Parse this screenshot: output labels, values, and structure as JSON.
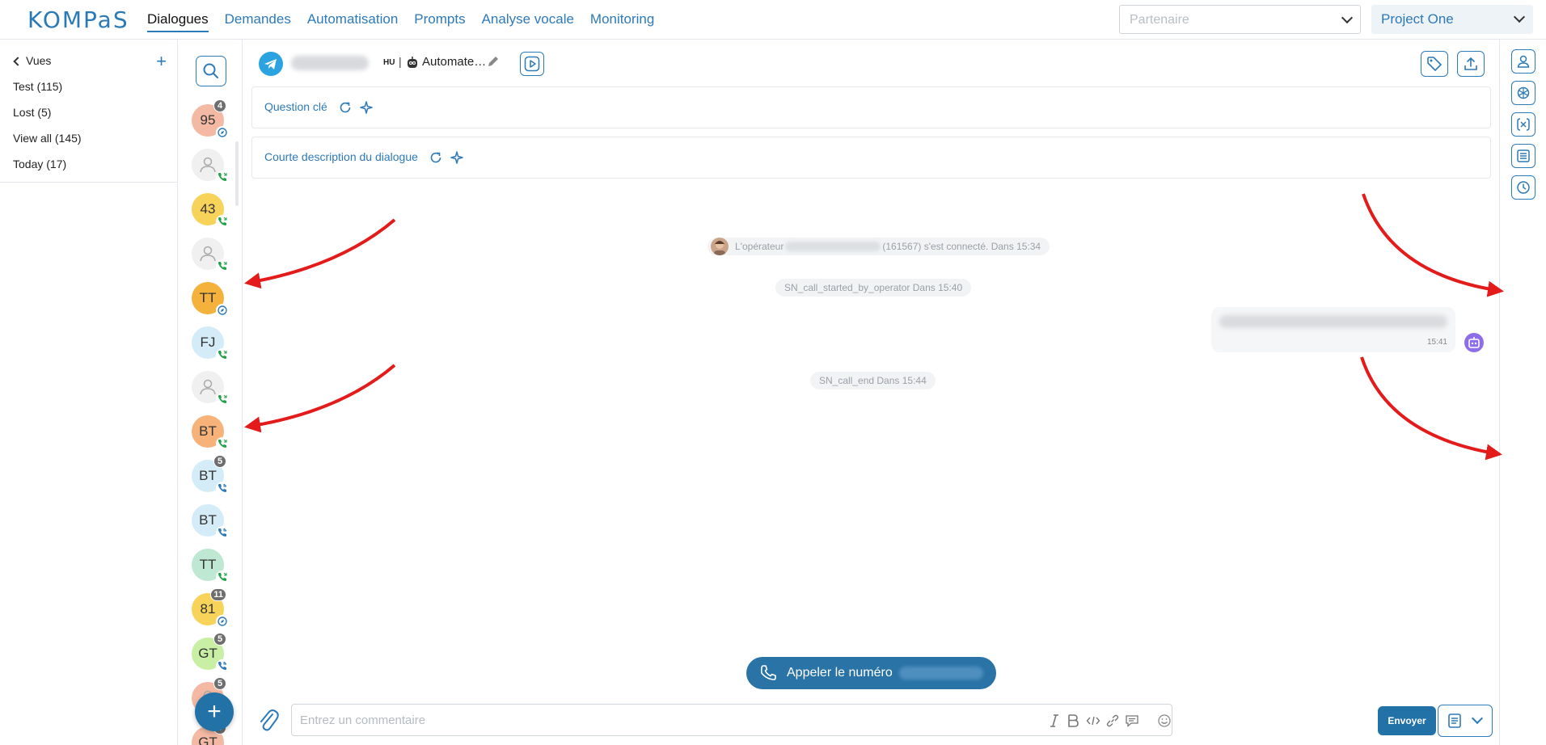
{
  "app": {
    "logo": "KOMPaS"
  },
  "nav": [
    {
      "label": "Dialogues",
      "active": true
    },
    {
      "label": "Demandes"
    },
    {
      "label": "Automatisation"
    },
    {
      "label": "Prompts"
    },
    {
      "label": "Analyse vocale"
    },
    {
      "label": "Monitoring"
    }
  ],
  "partner": {
    "placeholder": "Partenaire"
  },
  "project": {
    "selected": "Project One"
  },
  "views": {
    "title": "Vues",
    "add_label": "+",
    "items": [
      {
        "label": "Test",
        "count": "(115)"
      },
      {
        "label": "Lost",
        "count": "(5)"
      },
      {
        "label": "View all",
        "count": "(145)"
      },
      {
        "label": "Today",
        "count": "(17)"
      }
    ]
  },
  "dialogs": [
    {
      "initials": "95",
      "color": "#f4b9a3",
      "badge": "4",
      "channel": "chat"
    },
    {
      "initials": "",
      "color": "#f0f0f0",
      "badge": "",
      "channel": "call-in"
    },
    {
      "initials": "43",
      "color": "#f8d35a",
      "badge": "",
      "channel": "call-in"
    },
    {
      "initials": "",
      "color": "#f0f0f0",
      "badge": "",
      "channel": "call-in"
    },
    {
      "initials": "TT",
      "color": "#f4b13c",
      "badge": "",
      "channel": "chat"
    },
    {
      "initials": "FJ",
      "color": "#d4ecf8",
      "badge": "",
      "channel": "call-in"
    },
    {
      "initials": "",
      "color": "#f0f0f0",
      "badge": "",
      "channel": "call-in"
    },
    {
      "initials": "BT",
      "color": "#f7b27a",
      "badge": "",
      "channel": "call-in"
    },
    {
      "initials": "BT",
      "color": "#d4ecf8",
      "badge": "5",
      "channel": "call-out"
    },
    {
      "initials": "BT",
      "color": "#d4ecf8",
      "badge": "",
      "channel": "call-out"
    },
    {
      "initials": "TT",
      "color": "#bfe8d2",
      "badge": "",
      "channel": "call-in"
    },
    {
      "initials": "81",
      "color": "#f8d35a",
      "badge": "11",
      "channel": "chat"
    },
    {
      "initials": "GT",
      "color": "#c8efa4",
      "badge": "5",
      "channel": "call-out"
    },
    {
      "initials": "",
      "color": "#f4b9a3",
      "badge": "5",
      "channel": ""
    },
    {
      "initials": "GT",
      "color": "#f4b9a3",
      "badge": "5",
      "channel": ""
    }
  ],
  "fab": {
    "label": "+"
  },
  "header": {
    "lang": "HU",
    "separator": "|",
    "automation_name": "Automate…"
  },
  "cards": [
    {
      "label": "Question clé"
    },
    {
      "label": "Courte description du dialogue"
    }
  ],
  "messages": {
    "operator_prefix": "L'opérateur",
    "operator_suffix": "(161567) s'est connecté. Dans 15:34",
    "call_started": "SN_call_started_by_operator Dans 15:40",
    "bubble_time": "15:41",
    "call_end": "SN_call_end Dans 15:44"
  },
  "call_button": {
    "label": "Appeler le numéro"
  },
  "composer": {
    "placeholder": "Entrez un commentaire",
    "send_label": "Envoyer"
  },
  "colors": {
    "accent": "#2d7ab9",
    "primary_button": "#2272a8",
    "bot": "#8e6ee8",
    "arrow": "#e31b1b"
  }
}
